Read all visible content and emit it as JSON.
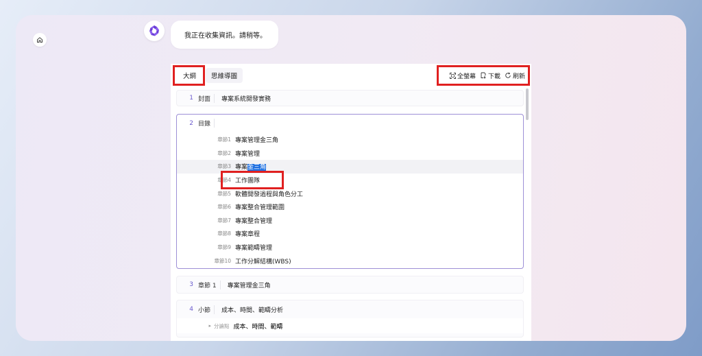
{
  "bubble": {
    "text": "我正在收集資訊。請稍等。"
  },
  "tabs": [
    {
      "label": "大綱",
      "active": true
    },
    {
      "label": "思維導圖",
      "active": false
    }
  ],
  "toolbar": {
    "fullscreen_label": "全螢幕",
    "download_label": "下載",
    "refresh_label": "刷新"
  },
  "cover": {
    "num": "1",
    "kind": "封面",
    "text": "專案系統開發實務"
  },
  "toc": {
    "num": "2",
    "kind": "目錄",
    "chapters": [
      {
        "label": "章節1",
        "text": "專案管理金三角"
      },
      {
        "label": "章節2",
        "text": "專案管理"
      },
      {
        "label": "章節3",
        "text_pre": "專案",
        "text_sel": "金三角"
      },
      {
        "label": "章節4",
        "text": "工作團隊"
      },
      {
        "label": "章節5",
        "text": "軟體開發過程與角色分工"
      },
      {
        "label": "章節6",
        "text": "專案整合管理範圍"
      },
      {
        "label": "章節7",
        "text": "專案整合管理"
      },
      {
        "label": "章節8",
        "text": "專案章程"
      },
      {
        "label": "章節9",
        "text": "專案範疇管理"
      },
      {
        "label": "章節10",
        "text": "工作分解結構(WBS)"
      }
    ]
  },
  "section3": {
    "num": "3",
    "kind": "章節 1",
    "text": "專案管理金三角"
  },
  "section4": {
    "num": "4",
    "kind": "小節",
    "text": "成本、時間、範疇分析",
    "sub": {
      "arrow": "▸",
      "label": "分論點",
      "text": "成本、時間、範疇"
    }
  },
  "icons": {
    "home": "home-icon",
    "logo": "aperture-logo-icon",
    "fullscreen": "fullscreen-icon",
    "download": "download-icon",
    "refresh": "refresh-icon"
  },
  "colors": {
    "accent": "#6a5acd",
    "highlight": "#e02020",
    "selection": "#1e6fe0"
  }
}
